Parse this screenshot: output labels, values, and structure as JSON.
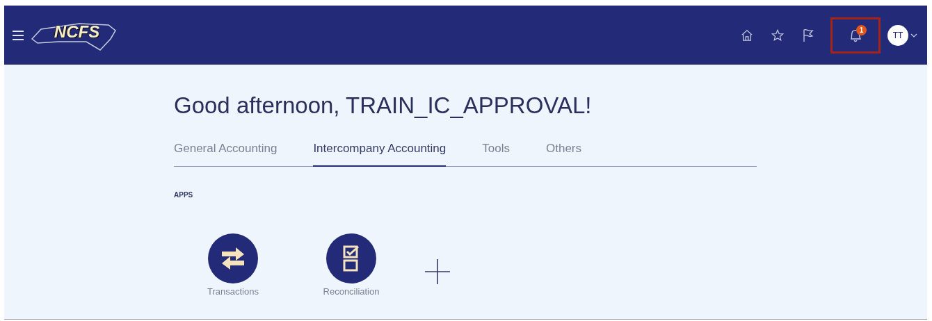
{
  "header": {
    "logo": "NCFS",
    "toolbar": [
      {
        "kind": "home"
      },
      {
        "kind": "favorites"
      },
      {
        "kind": "flag"
      },
      {
        "kind": "notifications",
        "badge": "1",
        "highlighted": true
      }
    ],
    "user": {
      "initials": "TT"
    }
  },
  "greeting": "Good afternoon, TRAIN_IC_APPROVAL!",
  "tabs": [
    {
      "label": "General Accounting",
      "selected": false
    },
    {
      "label": "Intercompany Accounting",
      "selected": true
    },
    {
      "label": "Tools",
      "selected": false
    },
    {
      "label": "Others",
      "selected": false
    }
  ],
  "section_title": "APPS",
  "apps": [
    {
      "kind": "transactions",
      "label": "Transactions"
    },
    {
      "kind": "reconciliation",
      "label": "Reconciliation"
    }
  ]
}
